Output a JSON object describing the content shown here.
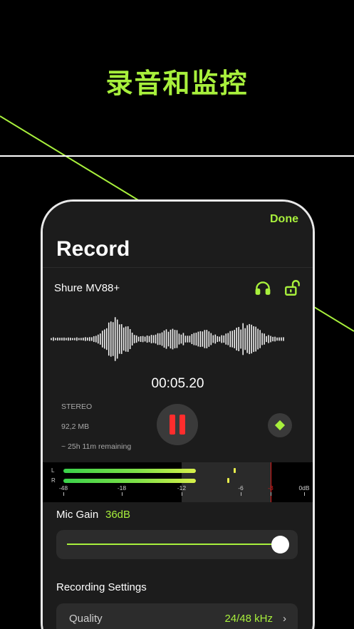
{
  "headline": "录音和监控",
  "nav": {
    "done_label": "Done"
  },
  "screen_title": "Record",
  "device": {
    "name": "Shure MV88+",
    "headphones_icon": "headphones-icon",
    "lock_icon": "unlock-icon"
  },
  "recording": {
    "elapsed": "00:05.20",
    "channel_mode": "STEREO",
    "file_size": "92,2 MB",
    "remaining": "~ 25h 11m remaining",
    "pause_icon": "pause-icon",
    "marker_icon": "diamond-marker-icon"
  },
  "meter": {
    "left_label": "L",
    "right_label": "R",
    "left_level": 0.72,
    "right_level": 0.72,
    "left_peak_db": -6.8,
    "right_peak_db": -7.6,
    "scale": [
      "-48",
      "-18",
      "-12",
      "-6",
      "-3",
      "0dB"
    ]
  },
  "mic_gain": {
    "label": "Mic Gain",
    "value": "36dB",
    "level": 0.95
  },
  "settings": {
    "section_title": "Recording Settings",
    "quality_label": "Quality",
    "quality_value": "24/48 kHz",
    "chevron": "›"
  },
  "colors": {
    "accent": "#a8f03c",
    "record_red": "#ff2d2d",
    "background": "#000000",
    "panel": "#1c1c1c"
  }
}
